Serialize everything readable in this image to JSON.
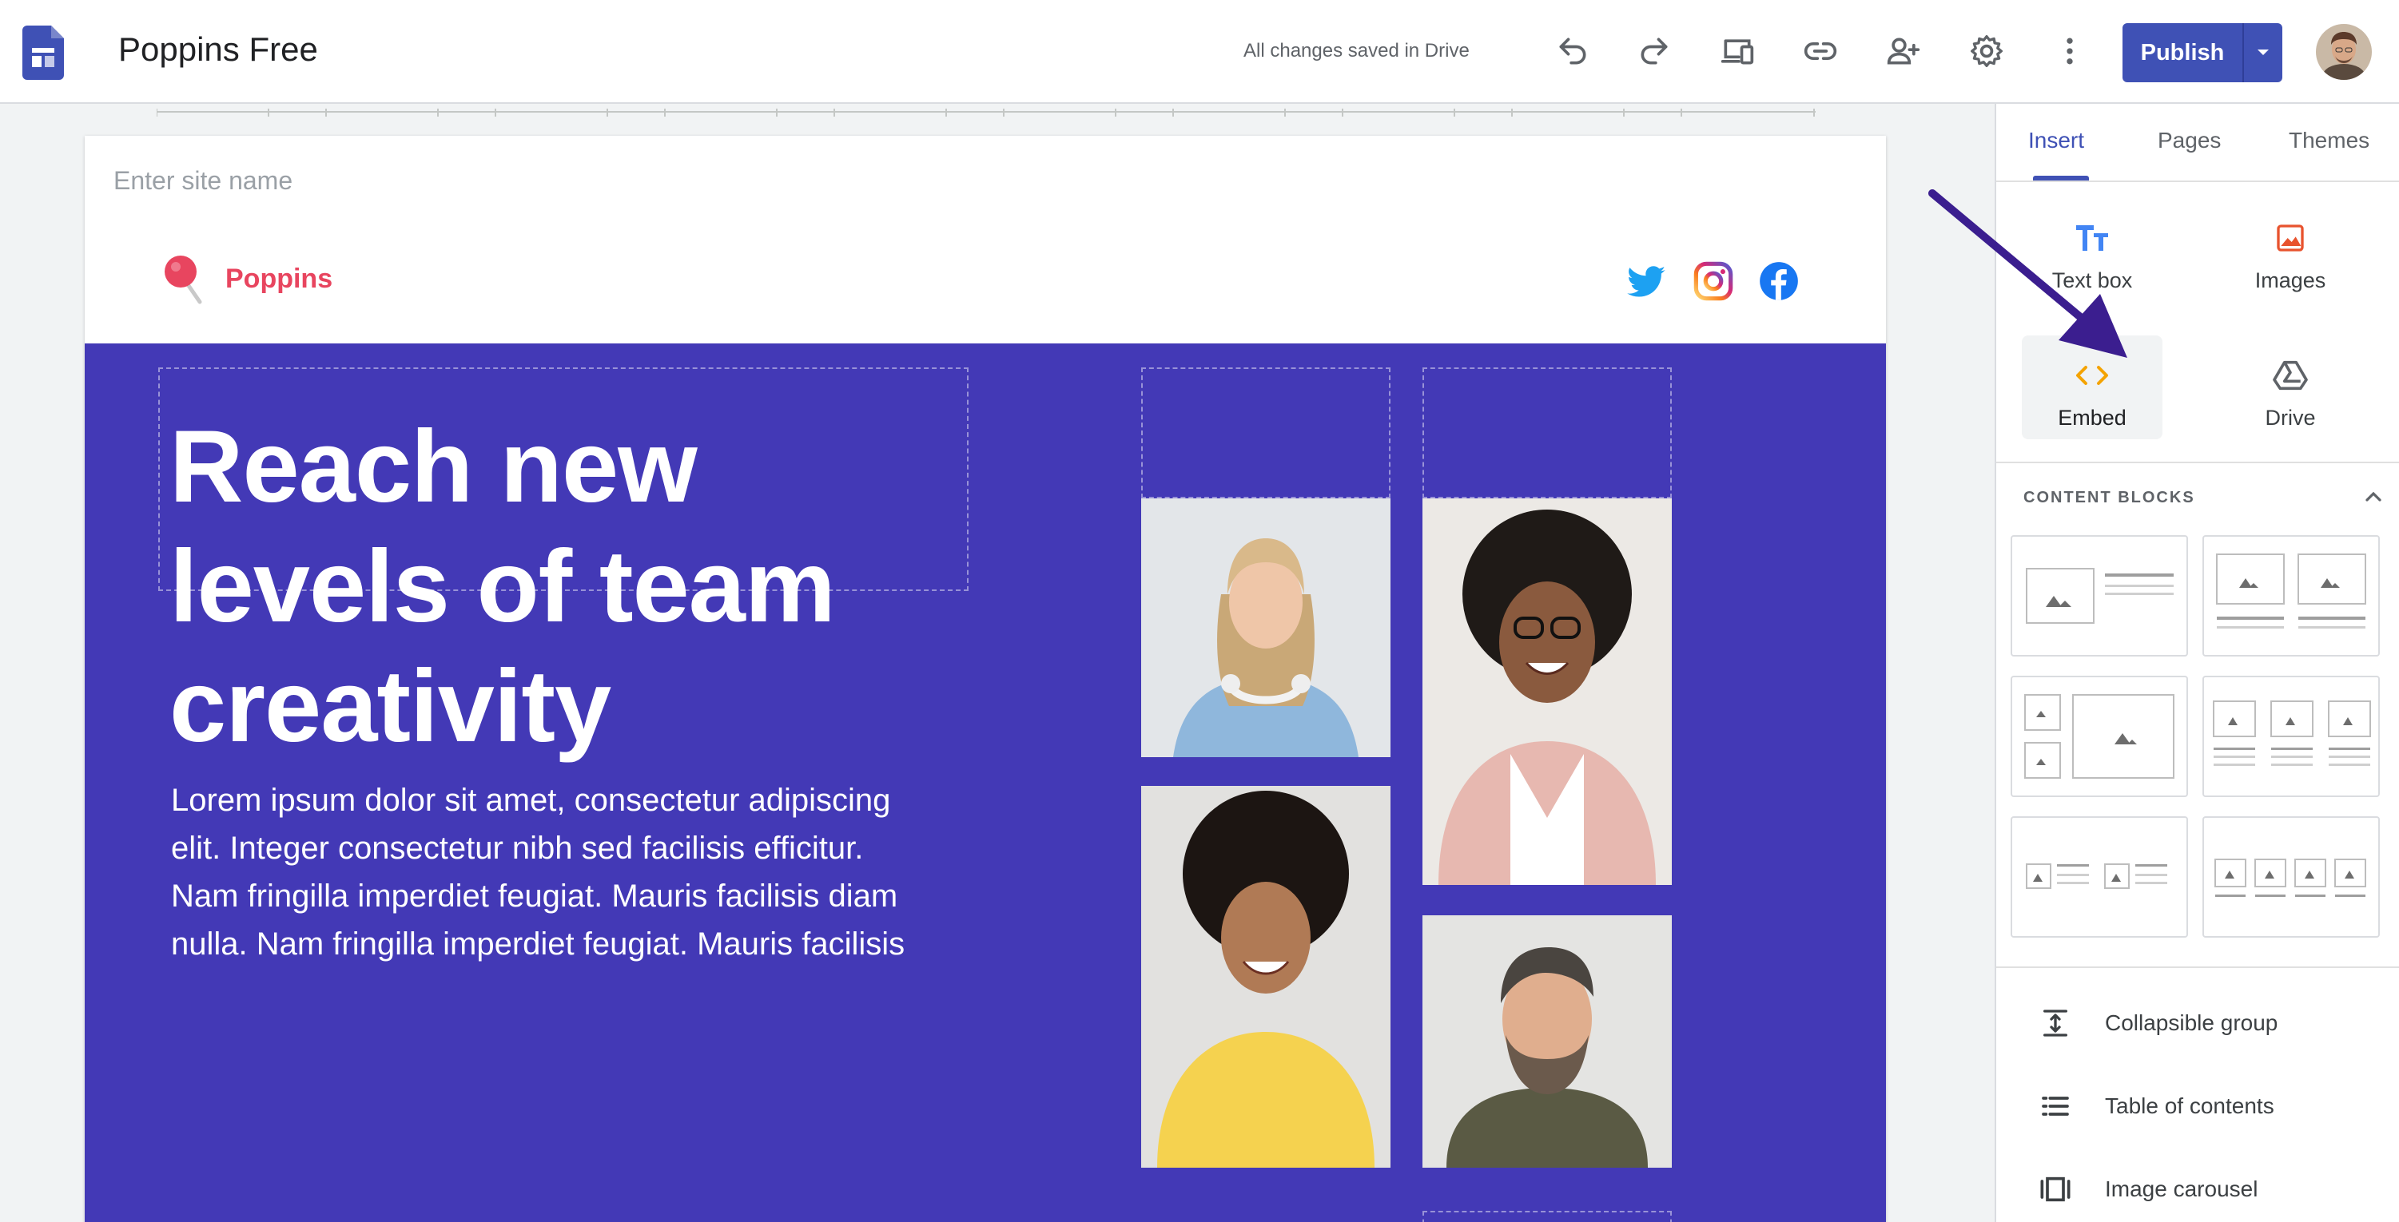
{
  "header": {
    "app_title": "Poppins Free",
    "save_status": "All changes saved in Drive",
    "publish_label": "Publish"
  },
  "page": {
    "site_name_placeholder": "Enter site name",
    "brand_name": "Poppins",
    "headline": [
      "Reach new",
      "levels of team",
      "creativity"
    ],
    "body_lines": [
      "Lorem ipsum dolor sit amet, consectetur adipiscing",
      "elit. Integer consectetur nibh sed facilisis efficitur.",
      "Nam fringilla imperdiet feugiat. Mauris facilisis diam",
      "nulla. Nam fringilla imperdiet feugiat. Mauris facilisis"
    ]
  },
  "panel": {
    "tabs": [
      {
        "label": "Insert",
        "active": true
      },
      {
        "label": "Pages",
        "active": false
      },
      {
        "label": "Themes",
        "active": false
      }
    ],
    "insert_items": [
      {
        "label": "Text box",
        "icon": "text-box-icon"
      },
      {
        "label": "Images",
        "icon": "image-icon"
      },
      {
        "label": "Embed",
        "icon": "embed-icon"
      },
      {
        "label": "Drive",
        "icon": "drive-icon"
      }
    ],
    "content_blocks_title": "CONTENT BLOCKS",
    "list_items": [
      {
        "label": "Collapsible group",
        "icon": "collapsible-icon"
      },
      {
        "label": "Table of contents",
        "icon": "toc-icon"
      },
      {
        "label": "Image carousel",
        "icon": "carousel-icon"
      }
    ]
  },
  "colors": {
    "brand_blue": "#3f51b5",
    "hero_bg": "#4339b6",
    "brand_pink": "#e8455f",
    "annotation_arrow": "#3b1e8f"
  }
}
